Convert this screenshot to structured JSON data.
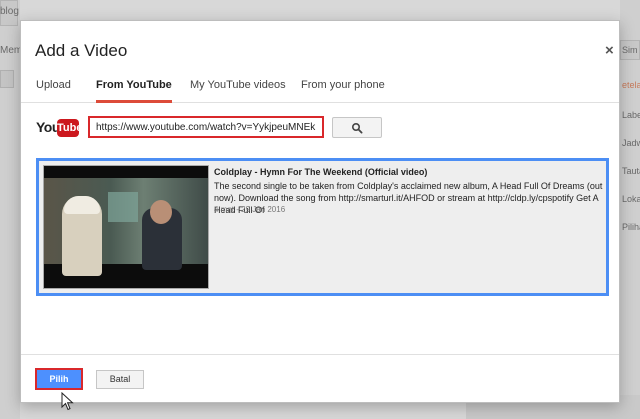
{
  "background": {
    "left_texts": [
      "blog",
      "Memai"
    ],
    "right_texts": [
      "Sim",
      "etela",
      "Label",
      "Jadw",
      "Tauta",
      "Loka",
      "Piliha"
    ]
  },
  "dialog": {
    "title": "Add a Video",
    "close_label": "×",
    "tabs": [
      {
        "label": "Upload",
        "active": false
      },
      {
        "label": "From YouTube",
        "active": true
      },
      {
        "label": "My YouTube videos",
        "active": false
      },
      {
        "label": "From your phone",
        "active": false
      }
    ],
    "youtube_logo": {
      "you": "You",
      "tube": "Tube"
    },
    "search": {
      "value": "https://www.youtube.com/watch?v=YykjpeuMNEk",
      "button_icon": "search-icon"
    },
    "result": {
      "title": "Coldplay - Hymn For The Weekend (Official video)",
      "description": "The second single to be taken from Coldplay's acclaimed new album, A Head Full Of Dreams (out now). Download the song from http://smarturl.it/AHFOD or stream at http://cldp.ly/cpspotify Get A Head Full Of",
      "meta": "4 mnt - 29 Jan 2016"
    },
    "footer": {
      "select_label": "Pilih",
      "cancel_label": "Batal"
    }
  },
  "colors": {
    "accent_red": "#d9282b",
    "selection_blue": "#4c8ef4",
    "primary_button": "#4d90fe",
    "youtube_red": "#cc181e"
  }
}
